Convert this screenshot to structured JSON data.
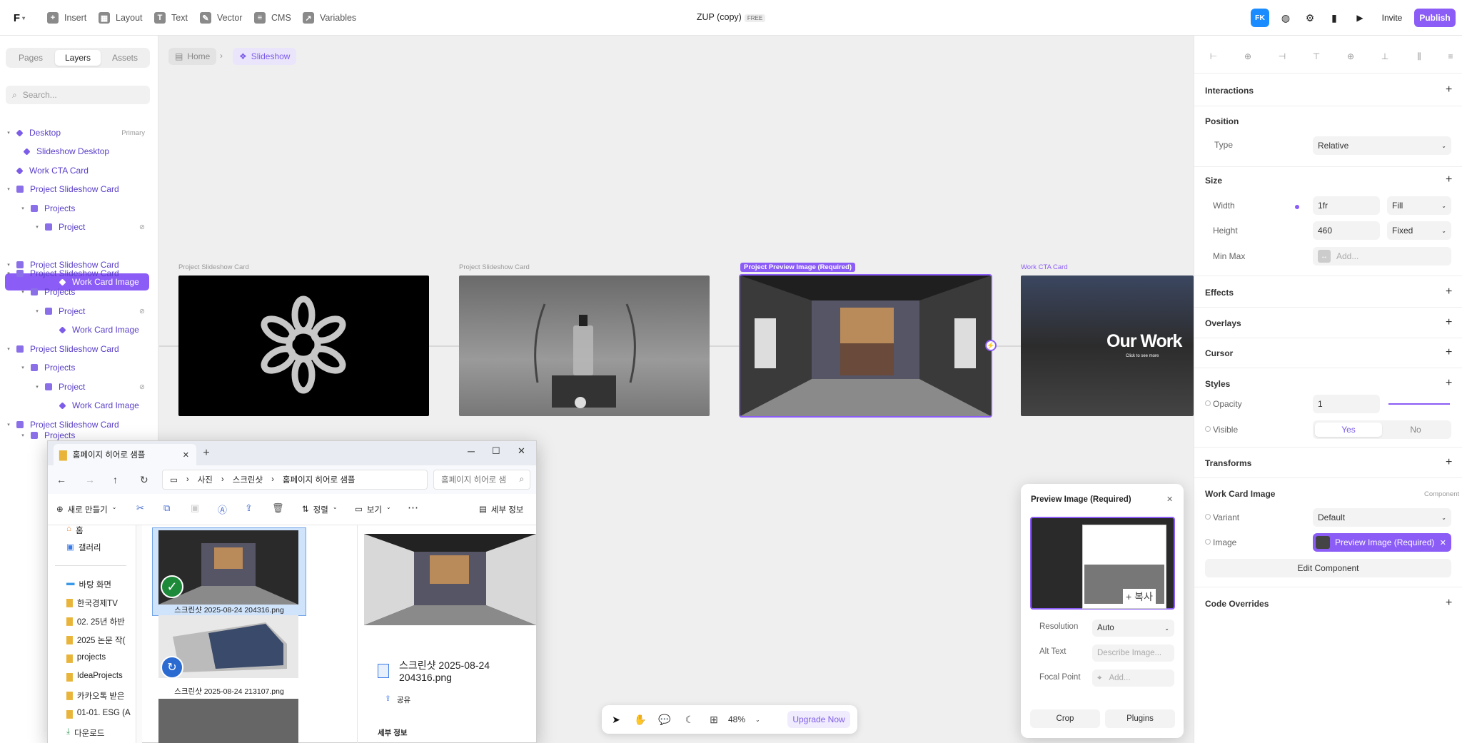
{
  "topbar": {
    "logo": "F",
    "items": [
      {
        "label": "Insert",
        "icon": "plus-icon"
      },
      {
        "label": "Layout",
        "icon": "layout-icon"
      },
      {
        "label": "Text",
        "icon": "text-icon"
      },
      {
        "label": "Vector",
        "icon": "vector-icon"
      },
      {
        "label": "CMS",
        "icon": "database-icon"
      },
      {
        "label": "Variables",
        "icon": "variables-icon"
      }
    ],
    "project_title": "ZUP (copy)",
    "plan_badge": "FREE",
    "avatar": "FK",
    "invite": "Invite",
    "publish": "Publish"
  },
  "leftpanel": {
    "tabs": [
      "Pages",
      "Layers",
      "Assets"
    ],
    "search_placeholder": "Search...",
    "layers": [
      {
        "label": "Desktop",
        "right": "Primary"
      },
      {
        "label": "Slideshow Desktop"
      },
      {
        "label": "Work CTA Card"
      },
      {
        "label": "Project Slideshow Card"
      },
      {
        "label": "Projects"
      },
      {
        "label": "Project"
      },
      {
        "label": "Work Card Image"
      },
      {
        "label": "Project Slideshow Card"
      },
      {
        "label": "Projects"
      },
      {
        "label": "Project"
      },
      {
        "label": "Work Card Image"
      },
      {
        "label": "Project Slideshow Card"
      },
      {
        "label": "Projects"
      },
      {
        "label": "Project"
      },
      {
        "label": "Work Card Image"
      },
      {
        "label": "Project Slideshow Card"
      },
      {
        "label": "Projects"
      }
    ]
  },
  "canvas": {
    "breadcrumb": [
      "Home",
      "Slideshow"
    ],
    "frames": [
      {
        "label": "Project Slideshow Card"
      },
      {
        "label": "Project Slideshow Card"
      },
      {
        "label": "Project Preview Image (Required)"
      },
      {
        "label": "Work CTA Card"
      }
    ],
    "cta_title": "Our Work",
    "cta_sub": "Click to see more"
  },
  "rightpanel": {
    "interactions": "Interactions",
    "position": {
      "title": "Position",
      "type_label": "Type",
      "type_value": "Relative"
    },
    "size": {
      "title": "Size",
      "width_label": "Width",
      "width_value": "1fr",
      "width_mode": "Fill",
      "height_label": "Height",
      "height_value": "460",
      "height_mode": "Fixed",
      "minmax_label": "Min Max",
      "minmax_placeholder": "Add..."
    },
    "effects": "Effects",
    "overlays": "Overlays",
    "cursor": "Cursor",
    "styles": {
      "title": "Styles",
      "opacity_label": "Opacity",
      "opacity_value": "1",
      "visible_label": "Visible",
      "yes": "Yes",
      "no": "No"
    },
    "transforms": "Transforms",
    "component": {
      "title": "Work Card Image",
      "tag": "Component",
      "variant_label": "Variant",
      "variant_value": "Default",
      "image_label": "Image",
      "image_value": "Preview Image (Required)",
      "edit": "Edit Component"
    },
    "code_overrides": "Code Overrides"
  },
  "preview": {
    "title": "Preview Image (Required)",
    "copy_label": "+ 복사",
    "resolution_label": "Resolution",
    "resolution_value": "Auto",
    "alt_label": "Alt Text",
    "alt_placeholder": "Describe Image...",
    "focal_label": "Focal Point",
    "focal_placeholder": "Add...",
    "crop": "Crop",
    "plugins": "Plugins"
  },
  "explorer": {
    "tab_title": "홈페이지 히어로 샘플",
    "path": [
      "사진",
      "스크린샷",
      "홈페이지 히어로 샘플"
    ],
    "search_placeholder": "홈페이지 히어로 샘",
    "toolbar": {
      "new": "새로 만들기",
      "sort": "정렬",
      "view": "보기",
      "details": "세부 정보"
    },
    "nav": [
      "홈",
      "갤러리",
      "바탕 화면",
      "한국경제TV",
      "02. 25년 하반",
      "2025 논문 작(",
      "projects",
      "IdeaProjects",
      "카카오톡 받은",
      "01-01. ESG (A",
      "다운로드"
    ],
    "files": [
      {
        "name": "스크린샷 2025-08-24 204316.png"
      },
      {
        "name": "스크린샷 2025-08-24 213107.png"
      }
    ],
    "detail_name": "스크린샷 2025-08-24 204316.png",
    "share": "공유",
    "detail_section": "세부 정보"
  },
  "toolbar": {
    "zoom": "48%",
    "upgrade": "Upgrade Now"
  }
}
